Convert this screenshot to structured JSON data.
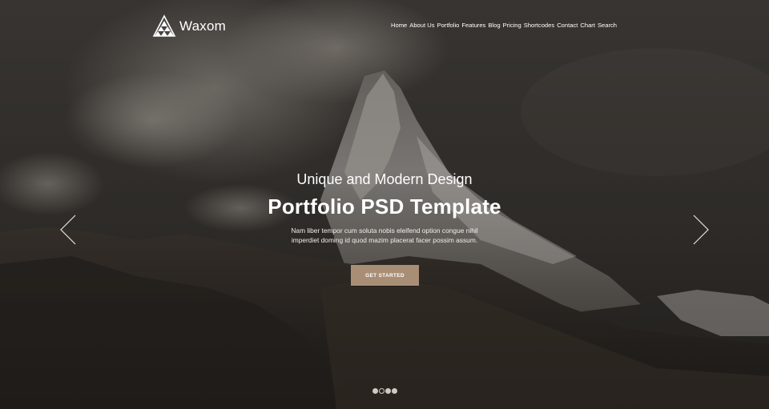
{
  "brand": {
    "name": "Waxom",
    "logo_icon": "triangle-mosaic-icon"
  },
  "nav": {
    "items": [
      {
        "label": "Home"
      },
      {
        "label": "About Us"
      },
      {
        "label": "Portfolio"
      },
      {
        "label": "Features"
      },
      {
        "label": "Blog"
      },
      {
        "label": "Pricing"
      },
      {
        "label": "Shortcodes"
      },
      {
        "label": "Contact"
      },
      {
        "label": "Chart"
      },
      {
        "label": "Search"
      }
    ]
  },
  "slider": {
    "prev_icon": "chevron-left-icon",
    "next_icon": "chevron-right-icon",
    "slide_count": 4,
    "active_slide": 2
  },
  "hero": {
    "subtitle": "Unique and Modern Design",
    "title": "Portfolio PSD Template",
    "description_line1": "Nam liber tempor cum soluta nobis eleifend option congue nihil",
    "description_line2": "imperdiet doming id quod mazim placerat facer possim assum.",
    "cta_label": "GET STARTED"
  },
  "colors": {
    "cta_background": "#a98e76",
    "overlay": "#2a2724",
    "text": "#ffffff"
  }
}
